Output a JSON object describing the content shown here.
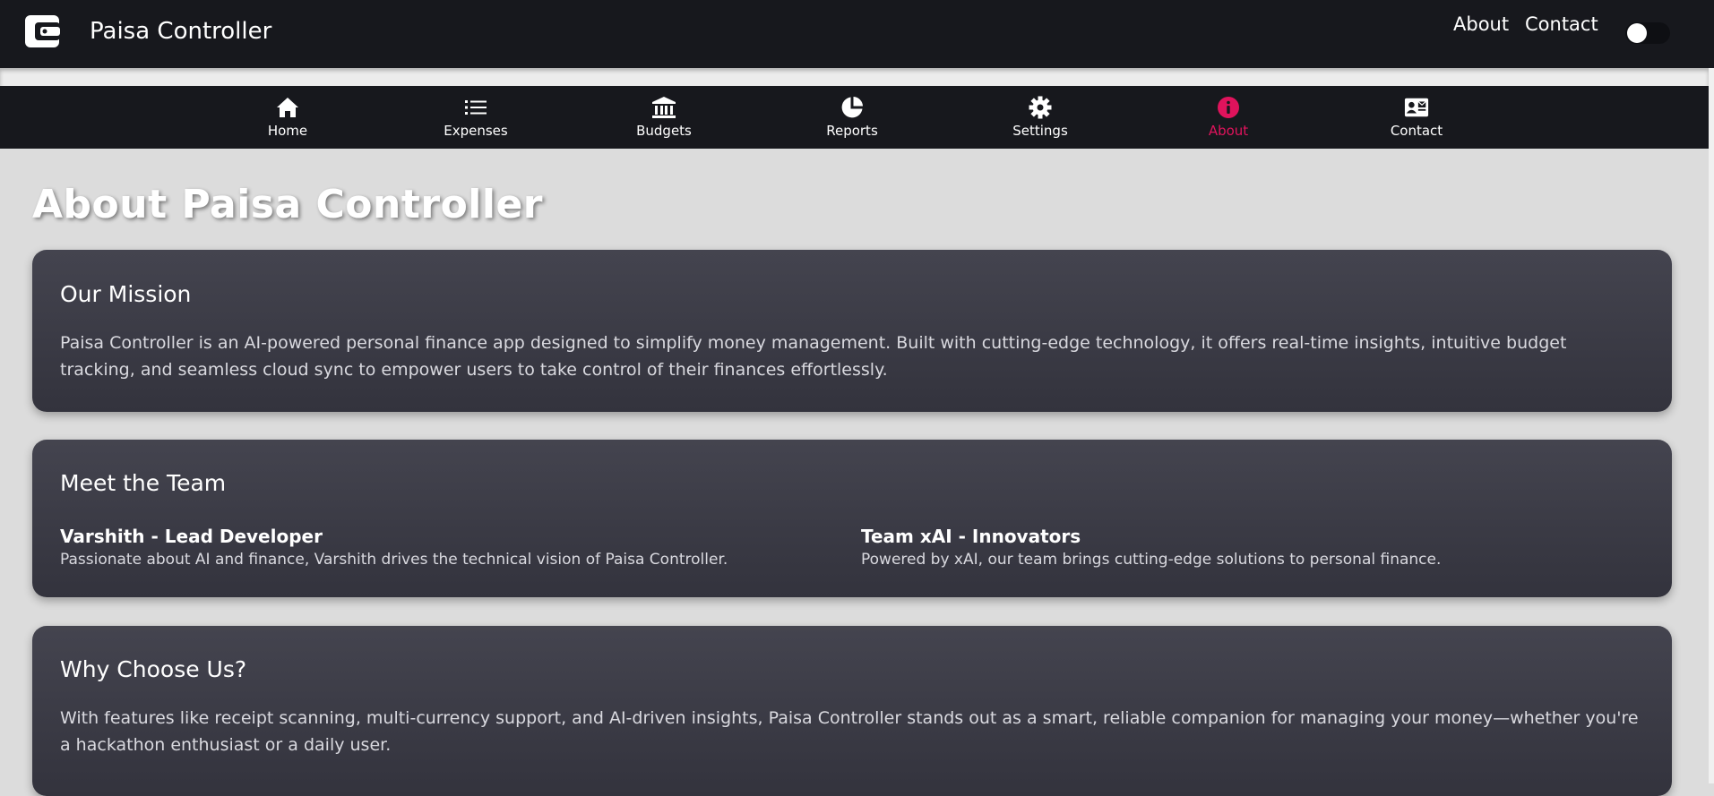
{
  "header": {
    "app_title": "Paisa Controller",
    "logo_icon": "wallet-icon",
    "links": [
      "About",
      "Contact"
    ],
    "theme_toggle": "off"
  },
  "nav": {
    "active_color": "#e0135c",
    "items": [
      {
        "label": "Home",
        "icon": "home-icon"
      },
      {
        "label": "Expenses",
        "icon": "list-icon"
      },
      {
        "label": "Budgets",
        "icon": "bank-icon"
      },
      {
        "label": "Reports",
        "icon": "pie-chart-icon"
      },
      {
        "label": "Settings",
        "icon": "gear-icon"
      },
      {
        "label": "About",
        "icon": "info-icon",
        "active": true
      },
      {
        "label": "Contact",
        "icon": "contact-card-icon"
      }
    ]
  },
  "page": {
    "title": "About Paisa Controller",
    "mission": {
      "heading": "Our Mission",
      "text": "Paisa Controller is an AI-powered personal finance app designed to simplify money management. Built with cutting-edge technology, it offers real-time insights, intuitive budget tracking, and seamless cloud sync to empower users to take control of their finances effortlessly."
    },
    "team": {
      "heading": "Meet the Team",
      "members": [
        {
          "name": "Varshith - Lead Developer",
          "desc": "Passionate about AI and finance, Varshith drives the technical vision of Paisa Controller."
        },
        {
          "name": "Team xAI - Innovators",
          "desc": "Powered by xAI, our team brings cutting-edge solutions to personal finance."
        }
      ]
    },
    "why": {
      "heading": "Why Choose Us?",
      "text": "With features like receipt scanning, multi-currency support, and AI-driven insights, Paisa Controller stands out as a smart, reliable companion for managing your money—whether you're a hackathon enthusiast or a daily user."
    }
  }
}
